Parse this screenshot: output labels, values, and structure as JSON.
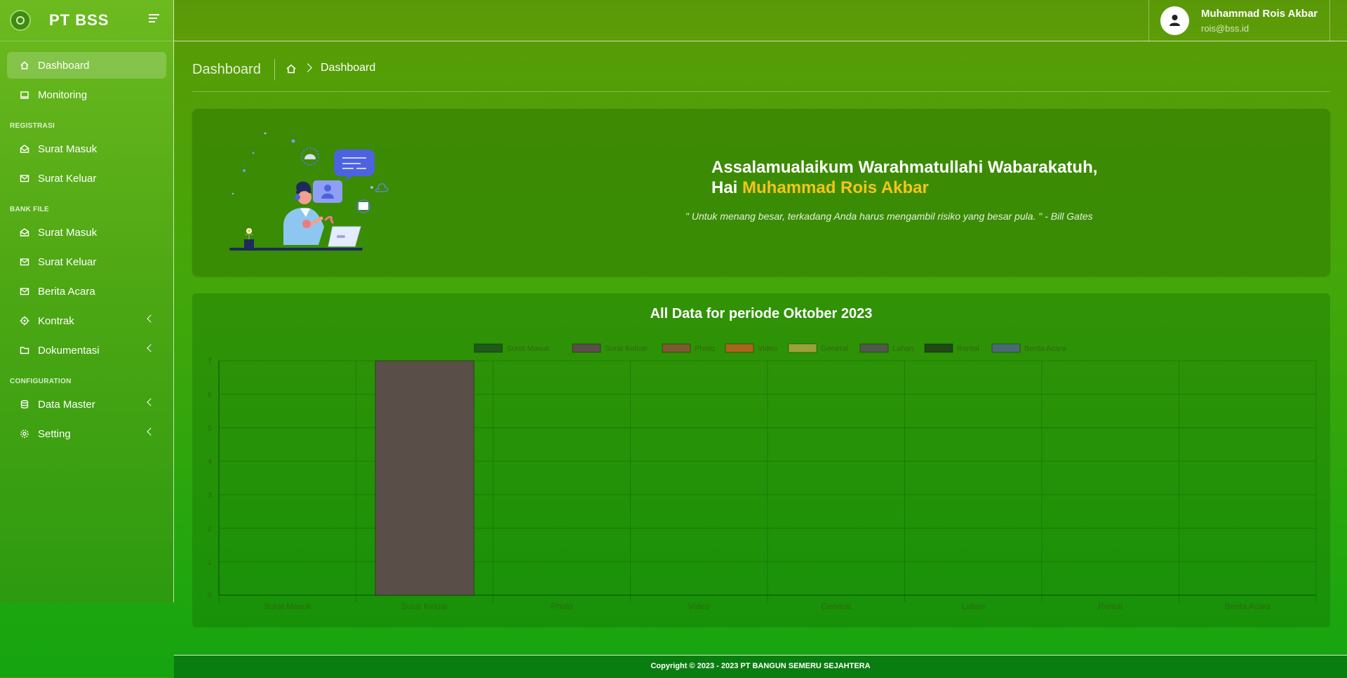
{
  "brand": {
    "name": "PT BSS"
  },
  "sidebar": {
    "main": [
      {
        "label": "Dashboard",
        "icon": "home-icon",
        "active": true
      },
      {
        "label": "Monitoring",
        "icon": "monitor-icon"
      }
    ],
    "sections": [
      {
        "title": "REGISTRASI",
        "items": [
          {
            "label": "Surat Masuk",
            "icon": "envelope-open-icon"
          },
          {
            "label": "Surat Keluar",
            "icon": "envelope-icon"
          }
        ]
      },
      {
        "title": "BANK FILE",
        "items": [
          {
            "label": "Surat Masuk",
            "icon": "envelope-open-icon"
          },
          {
            "label": "Surat Keluar",
            "icon": "envelope-icon"
          },
          {
            "label": "Berita Acara",
            "icon": "envelope-icon"
          },
          {
            "label": "Kontrak",
            "icon": "target-icon",
            "expandable": true
          },
          {
            "label": "Dokumentasi",
            "icon": "folder-icon",
            "expandable": true
          }
        ]
      },
      {
        "title": "CONFIGURATION",
        "items": [
          {
            "label": "Data Master",
            "icon": "database-icon",
            "expandable": true
          },
          {
            "label": "Setting",
            "icon": "gear-icon",
            "expandable": true
          }
        ]
      }
    ]
  },
  "user": {
    "name": "Muhammad Rois Akbar",
    "email": "rois@bss.id"
  },
  "page": {
    "title": "Dashboard",
    "breadcrumb": "Dashboard"
  },
  "welcome": {
    "greeting": "Assalamualaikum Warahmatullahi Wabarakatuh,",
    "hi": "Hai",
    "name": "Muhammad Rois Akbar",
    "quote": "\" Untuk menang besar, terkadang Anda harus mengambil risiko yang besar pula. \" - Bill Gates"
  },
  "chart_data": {
    "type": "bar",
    "title": "All Data for periode Oktober 2023",
    "categories": [
      "Surat Masuk",
      "Surat Keluar",
      "Photo",
      "Video",
      "General",
      "Lahan",
      "Rental",
      "Berita Acara"
    ],
    "series": [
      {
        "name": "Surat Masuk",
        "color": "#1e5a1a"
      },
      {
        "name": "Surat Keluar",
        "color": "#5a4f48"
      },
      {
        "name": "Photo",
        "color": "#7a5a30"
      },
      {
        "name": "Video",
        "color": "#a8651c"
      },
      {
        "name": "General",
        "color": "#9aa23a"
      },
      {
        "name": "Lahan",
        "color": "#4d5a48"
      },
      {
        "name": "Rental",
        "color": "#1f4a12"
      },
      {
        "name": "Berita Acara",
        "color": "#4a6a72"
      }
    ],
    "values": [
      0,
      7,
      0,
      0,
      0,
      0,
      0,
      0
    ],
    "ylim": [
      0,
      7
    ],
    "yticks": [
      "0",
      "1",
      "2",
      "3",
      "4",
      "5",
      "6",
      "7"
    ],
    "grid": true,
    "legend": "top"
  },
  "footer": {
    "text": "Copyright © 2023 - 2023 PT BANGUN SEMERU SEJAHTERA"
  }
}
